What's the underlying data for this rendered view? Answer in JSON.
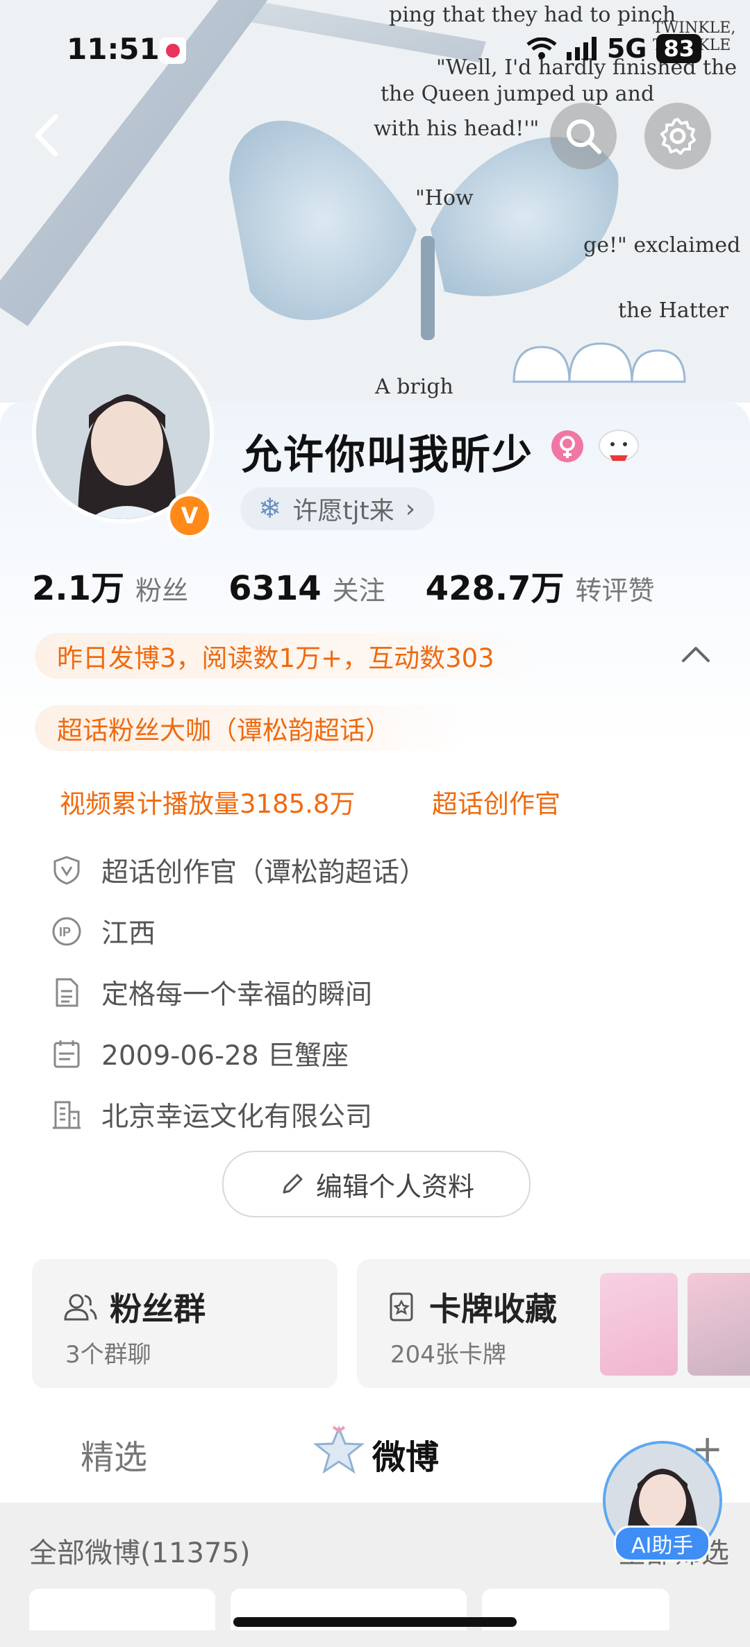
{
  "status_bar": {
    "time": "11:51",
    "network": "5G",
    "battery": "83"
  },
  "banner_text": [
    "ping that they had to pinch",
    "\"Well, I'd hardly finished the",
    "the Queen jumped up and",
    "with his head!'\"",
    "\"How",
    "ge!\" exclaimed",
    "the Hatter",
    "A brigh",
    "TWINKLE, TWINKLE"
  ],
  "profile": {
    "name": "允许你叫我昕少",
    "subname": "许愿tjt来",
    "verified_badge": "V"
  },
  "stats": [
    {
      "value": "2.1万",
      "label": "粉丝"
    },
    {
      "value": "6314",
      "label": "关注"
    },
    {
      "value": "428.7万",
      "label": "转评赞"
    }
  ],
  "highlights": {
    "activity": "昨日发博3，阅读数1万+，互动数303",
    "super_fan": "超话粉丝大咖（谭松韵超话）",
    "video_plays": "视频累计播放量3185.8万",
    "creator": "超话创作官"
  },
  "info": [
    {
      "icon": "shield-v-icon",
      "text": "超话创作官（谭松韵超话）"
    },
    {
      "icon": "ip-icon",
      "text": "江西"
    },
    {
      "icon": "document-icon",
      "text": "定格每一个幸福的瞬间"
    },
    {
      "icon": "calendar-icon",
      "text": "2009-06-28 巨蟹座"
    },
    {
      "icon": "building-icon",
      "text": "北京幸运文化有限公司"
    }
  ],
  "edit_profile_label": "编辑个人资料",
  "cards": {
    "fans_group": {
      "title": "粉丝群",
      "sub": "3个群聊"
    },
    "card_collection": {
      "title": "卡牌收藏",
      "sub": "204张卡牌"
    }
  },
  "tabs": {
    "featured": "精选",
    "weibo": "微博",
    "more": "+"
  },
  "feed": {
    "title": "全部微博(11375)",
    "filter": "全部筛选"
  },
  "ai_assistant": {
    "label": "AI助手"
  },
  "colors": {
    "accent": "#f06a0f",
    "verified": "#ff8a1a",
    "ai_blue": "#3f8ef5"
  }
}
